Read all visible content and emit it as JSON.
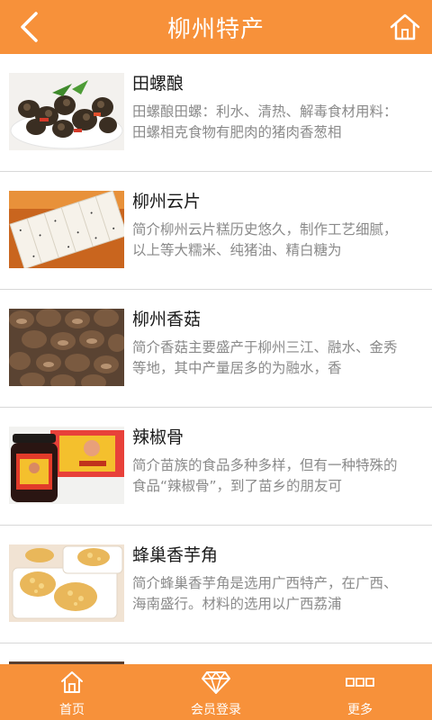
{
  "header": {
    "title": "柳州特产",
    "back_icon": "chevron-left-icon",
    "home_icon": "home-icon"
  },
  "list": [
    {
      "name": "田螺酿",
      "desc": "田螺酿田螺：利水、清热、解毒食材用料：田螺相克食物有肥肉的猪肉香葱相",
      "image": "stuffed-snails-photo"
    },
    {
      "name": "柳州云片",
      "desc": "简介柳州云片糕历史悠久，制作工艺细腻，以上等大糯米、纯猪油、精白糖为",
      "image": "yunpian-cake-photo"
    },
    {
      "name": "柳州香菇",
      "desc": "简介香菇主要盛产于柳州三江、融水、金秀等地，其中产量居多的为融水，香",
      "image": "shiitake-mushrooms-photo"
    },
    {
      "name": "辣椒骨",
      "desc": "简介苗族的食品多种多样，但有一种特殊的食品“辣椒骨”，到了苗乡的朋友可",
      "image": "chili-bone-jar-photo"
    },
    {
      "name": "蜂巢香芋角",
      "desc": "简介蜂巢香芋角是选用广西特产，在广西、海南盛行。材料的选用以广西荔浦",
      "image": "taro-puffs-photo"
    }
  ],
  "tabbar": {
    "items": [
      {
        "label": "首页",
        "icon": "home-icon"
      },
      {
        "label": "会员登录",
        "icon": "diamond-icon"
      },
      {
        "label": "更多",
        "icon": "more-icon"
      }
    ]
  },
  "colors": {
    "accent": "#f7913a",
    "title_text": "#1a1a1a",
    "desc_text": "#8a8a8a",
    "divider": "#d8d8d8"
  }
}
